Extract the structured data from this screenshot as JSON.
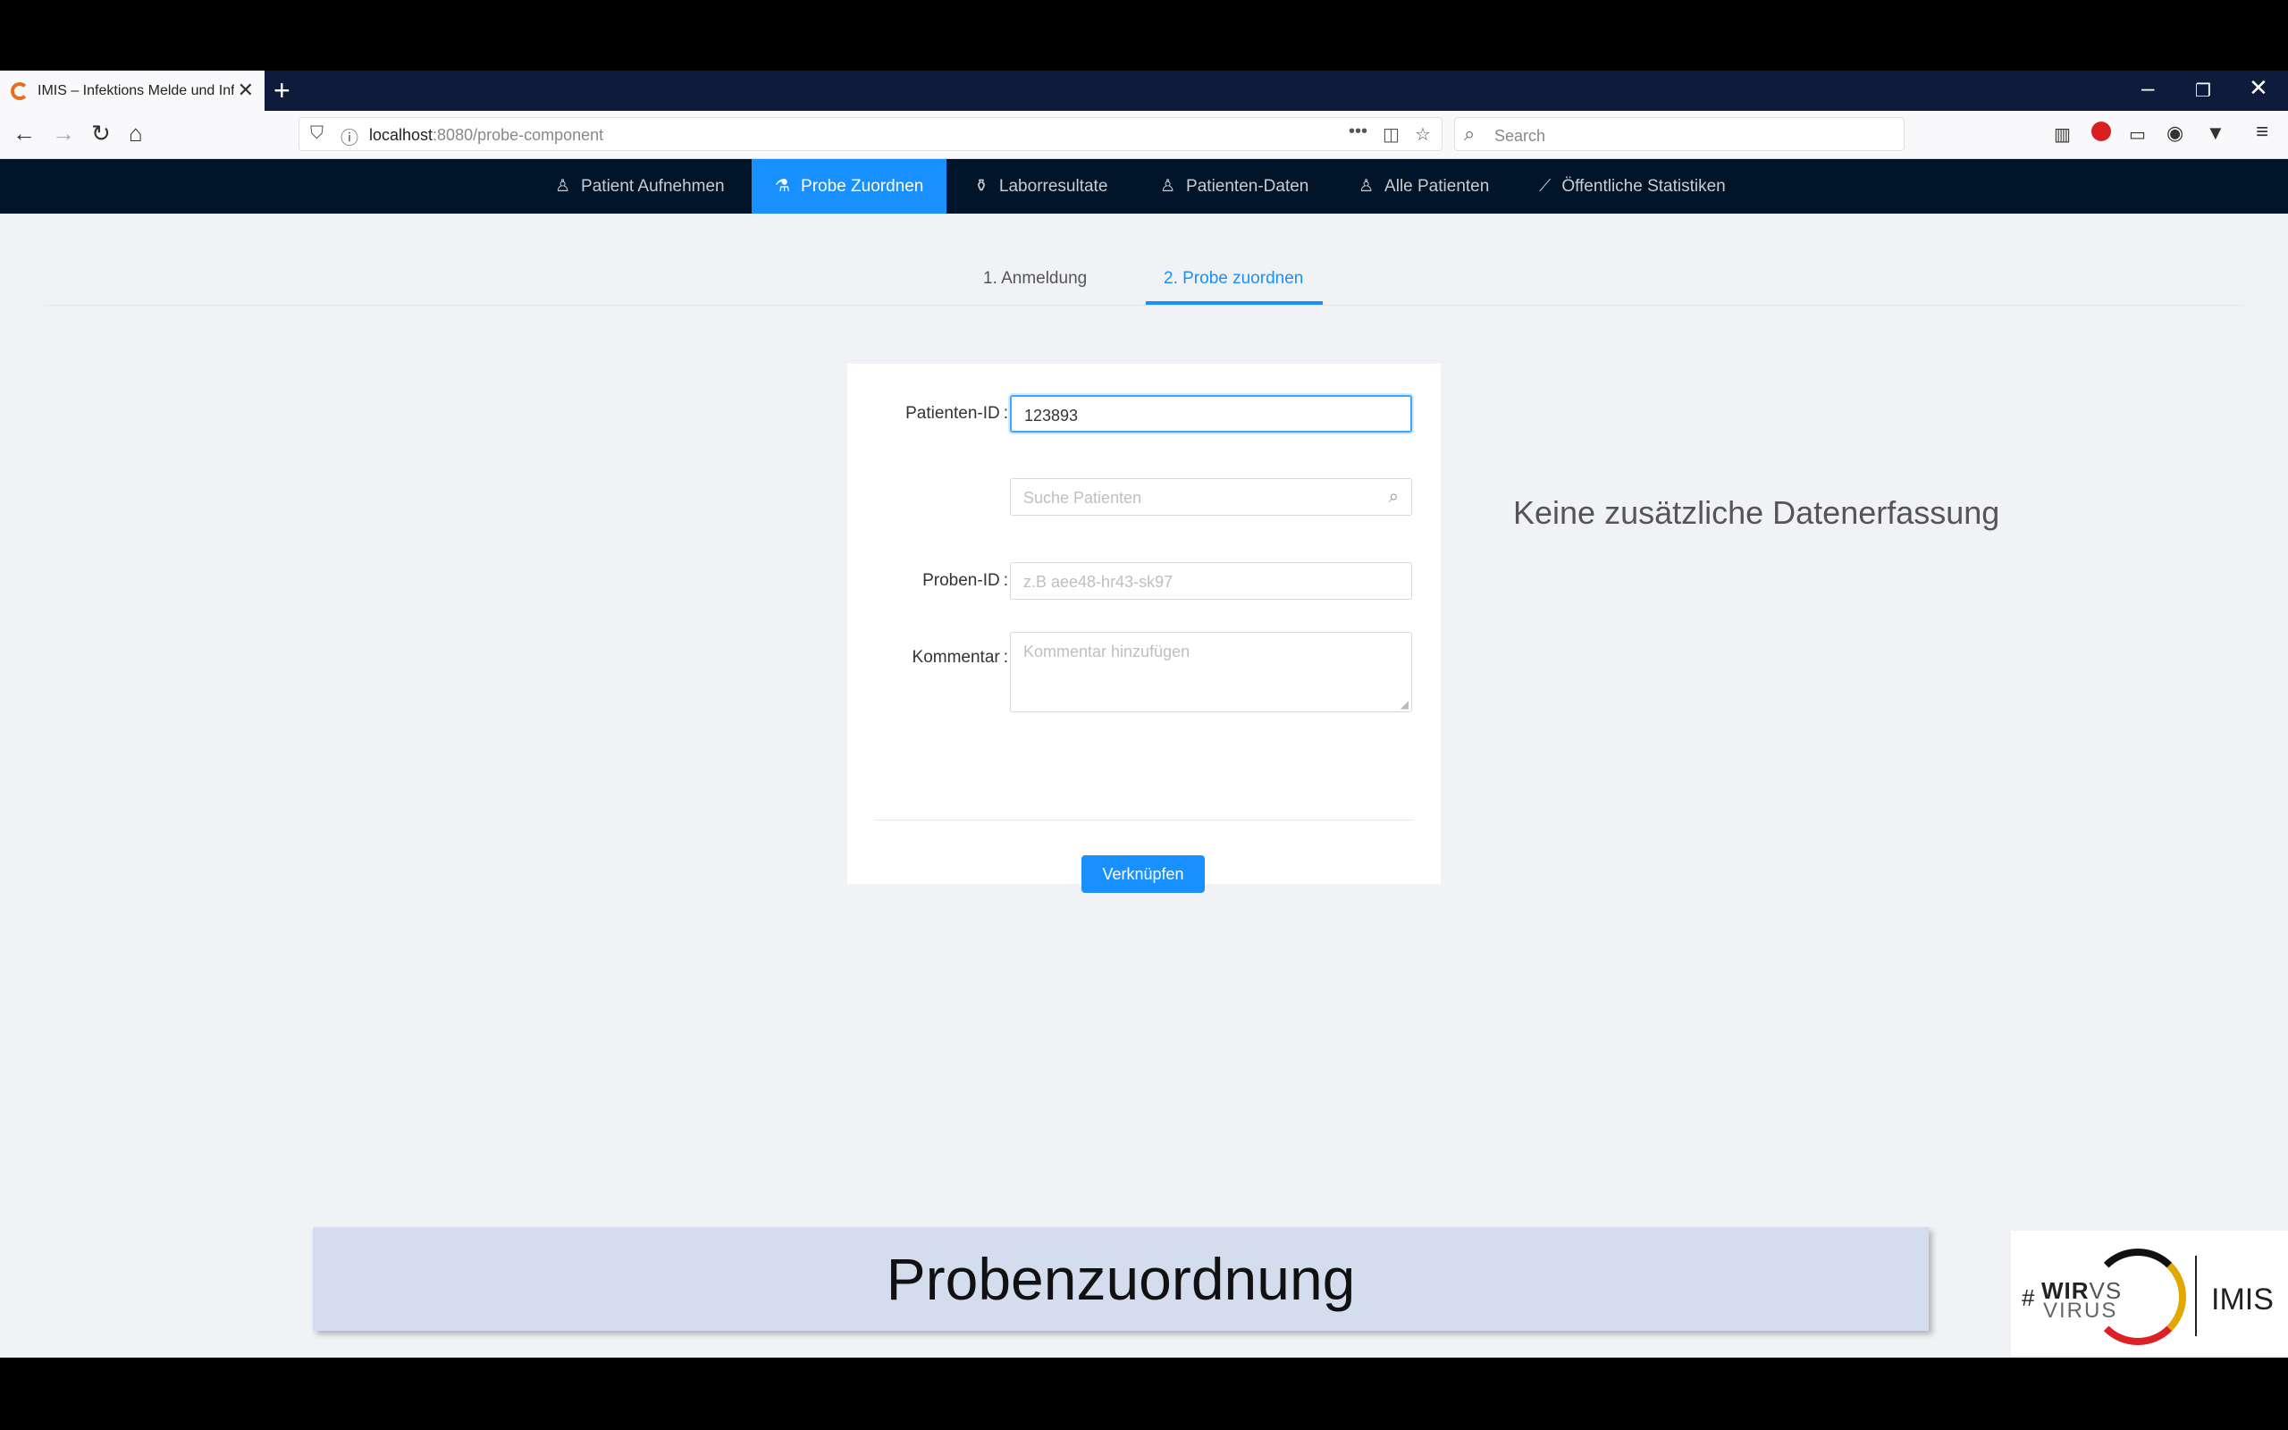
{
  "browser": {
    "tab_title": "IMIS – Infektions Melde und Inf",
    "url_host": "localhost",
    "url_path": ":8080/probe-component",
    "search_placeholder": "Search",
    "overflow_label": "•••"
  },
  "app_nav": {
    "items": [
      {
        "label": "Patient Aufnehmen",
        "icon": "user-icon"
      },
      {
        "label": "Probe Zuordnen",
        "icon": "experiment-icon",
        "active": true
      },
      {
        "label": "Laborresultate",
        "icon": "flask-icon"
      },
      {
        "label": "Patienten-Daten",
        "icon": "user-icon"
      },
      {
        "label": "Alle Patienten",
        "icon": "team-icon"
      },
      {
        "label": "Öffentliche Statistiken",
        "icon": "chart-icon"
      }
    ]
  },
  "steps": [
    {
      "label": "1. Anmeldung"
    },
    {
      "label": "2. Probe zuordnen",
      "active": true
    }
  ],
  "form": {
    "patient_id_label": "Patienten-ID",
    "patient_id_value": "123893",
    "search_placeholder": "Suche Patienten",
    "proben_id_label": "Proben-ID",
    "proben_id_placeholder": "z.B aee48-hr43-sk97",
    "kommentar_label": "Kommentar",
    "kommentar_placeholder": "Kommentar hinzufügen",
    "submit_label": "Verknüpfen"
  },
  "side_note": "Keine zusätzliche Datenerfassung",
  "caption": "Probenzuordnung",
  "logo": {
    "hash": "#",
    "wir": "WIR",
    "vs": "VS",
    "virus": "VIRUS",
    "imis": "IMIS"
  },
  "colors": {
    "accent": "#1890ff",
    "nav_bg": "#001529",
    "caption_bg": "#d3dded"
  }
}
